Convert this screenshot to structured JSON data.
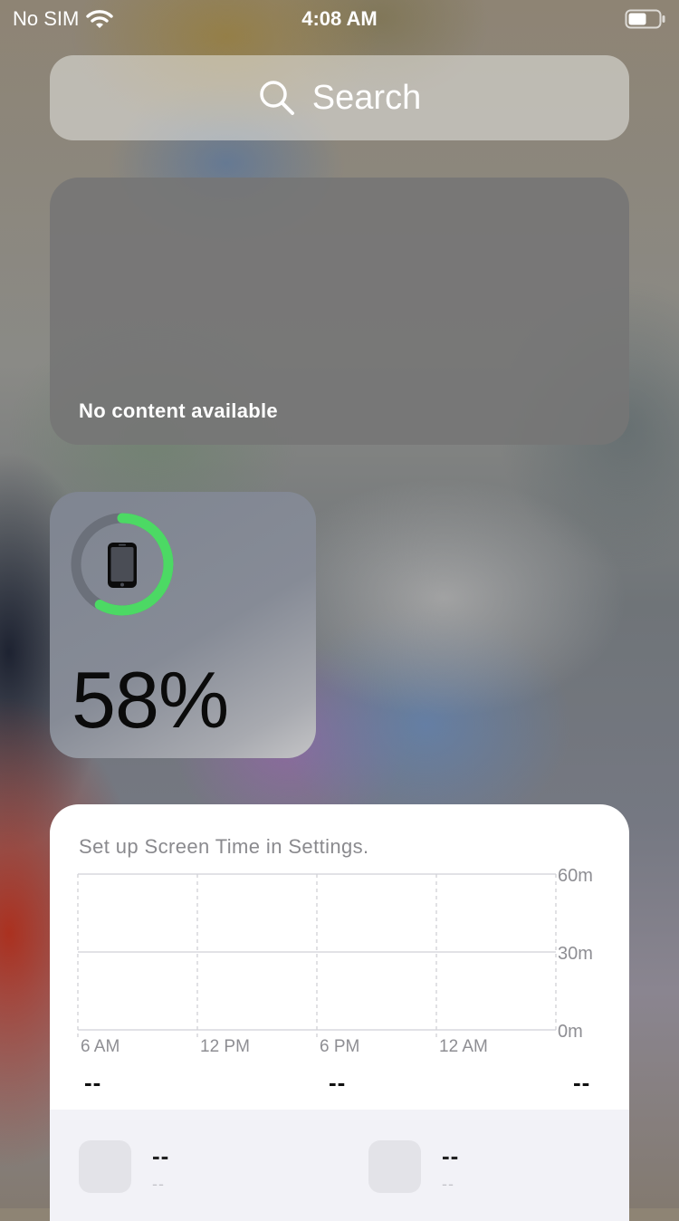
{
  "status_bar": {
    "carrier": "No SIM",
    "time": "4:08 AM",
    "icons": [
      "wifi-icon",
      "battery-icon"
    ]
  },
  "search": {
    "placeholder": "Search",
    "icon": "search-icon"
  },
  "empty_widget": {
    "message": "No content available"
  },
  "battery_widget": {
    "percent": 58,
    "percent_label": "58%",
    "device_icon": "iphone-icon",
    "ring_color": "#4cd964"
  },
  "screen_time": {
    "message": "Set up Screen Time in Settings.",
    "summary_values": [
      "--",
      "--",
      "--"
    ],
    "apps": [
      {
        "primary": "--",
        "secondary": "--"
      },
      {
        "primary": "--",
        "secondary": "--"
      }
    ]
  },
  "chart_data": {
    "type": "bar",
    "x_tick_labels": [
      "6 AM",
      "12 PM",
      "6 PM",
      "12 AM"
    ],
    "y_tick_labels": [
      "60m",
      "30m",
      "0m"
    ],
    "ylim": [
      0,
      60
    ],
    "values": [],
    "grid": true
  }
}
